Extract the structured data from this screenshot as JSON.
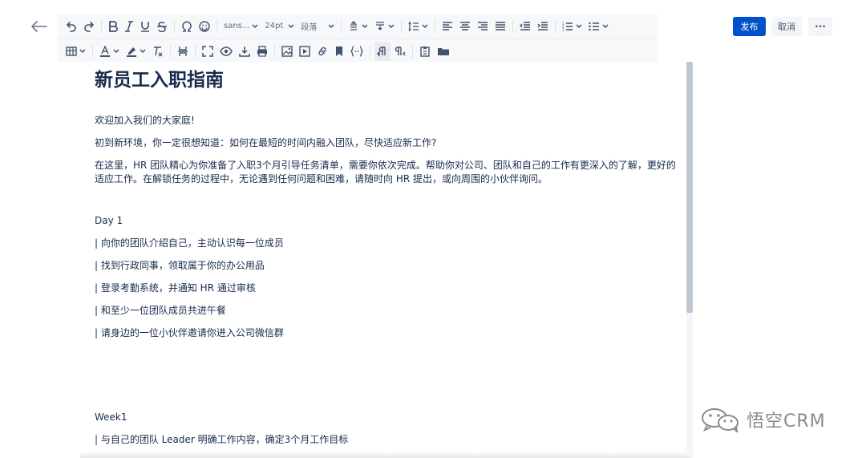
{
  "toolbar": {
    "font_family": "sans...",
    "font_size": "24pt",
    "paragraph_style": "段落"
  },
  "actions": {
    "publish": "发布",
    "cancel": "取消",
    "more": "···"
  },
  "document": {
    "title": "新员工入职指南",
    "welcome": "欢迎加入我们的大家庭!",
    "intro1": "初到新环境，你一定很想知道：如何在最短的时间内融入团队，尽快适应新工作?",
    "intro2_line1": "在这里，HR 团队精心为你准备了入职3个月引导任务清单，需要你依次完成。帮助你对公司、团队和自己的工作有更深入的了解，更好的",
    "intro2_line2": "适应工作。在解锁任务的过程中，无论遇到任何问题和困难，请随时向 HR 提出，或向周围的小伙伴询问。",
    "day1_heading": "Day 1",
    "day1_items": [
      "| 向你的团队介绍自己，主动认识每一位成员",
      "| 找到行政同事，领取属于你的办公用品",
      "| 登录考勤系统，并通知 HR 通过审核",
      "| 和至少一位团队成员共进午餐",
      "| 请身边的一位小伙伴邀请你进入公司微信群"
    ],
    "week1_heading": "Week1",
    "week1_items": [
      "| 与自己的团队 Leader 明确工作内容，确定3个月工作目标"
    ]
  },
  "watermark": {
    "text": "悟空CRM"
  }
}
